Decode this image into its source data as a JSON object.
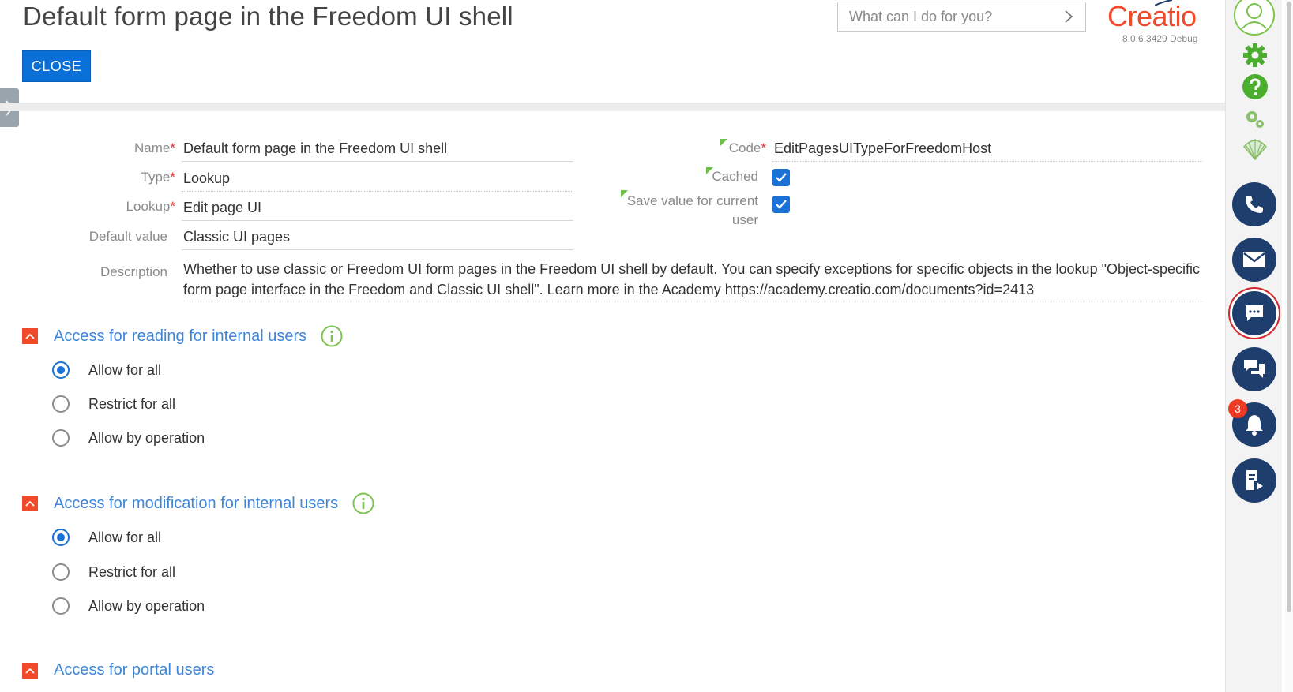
{
  "header": {
    "title": "Default form page in the Freedom UI shell",
    "close_label": "CLOSE",
    "search_placeholder": "What can I do for you?",
    "logo_text": "Creatio",
    "version": "8.0.6.3429 Debug"
  },
  "form": {
    "name_label": "Name",
    "name_value": "Default form page in the Freedom UI shell",
    "type_label": "Type",
    "type_value": "Lookup",
    "lookup_label": "Lookup",
    "lookup_value": "Edit page UI",
    "default_value_label": "Default value",
    "default_value_value": "Classic UI pages",
    "description_label": "Description",
    "description_value": "Whether to use classic or Freedom UI form pages in the Freedom UI shell by default. You can specify exceptions for specific objects in the lookup \"Object-specific form page interface in the Freedom and Classic UI shell\". Learn more in the Academy https://academy.creatio.com/documents?id=2413",
    "code_label": "Code",
    "code_value": "EditPagesUITypeForFreedomHost",
    "cached_label": "Cached",
    "cached_checked": true,
    "save_value_label_line1": "Save value for current",
    "save_value_label_line2": "user",
    "save_value_checked": true,
    "required_mark": "*"
  },
  "sections": [
    {
      "title": "Access for reading for internal users",
      "options": [
        "Allow for all",
        "Restrict for all",
        "Allow by operation"
      ],
      "selected": 0
    },
    {
      "title": "Access for modification for internal users",
      "options": [
        "Allow for all",
        "Restrict for all",
        "Allow by operation"
      ],
      "selected": 0
    },
    {
      "title": "Access for portal users"
    }
  ],
  "rail": {
    "notification_count": "3",
    "icons": [
      "profile-icon",
      "gear-icon",
      "help-icon",
      "system-settings-icon",
      "shell-icon",
      "phone-icon",
      "email-icon",
      "chat-icon",
      "feed-icon",
      "bell-icon",
      "process-icon"
    ]
  },
  "colors": {
    "accent": "#0a6fd6",
    "brand": "#ee4a2b",
    "rail_button": "#1e3e6e",
    "section_link": "#3f86d8",
    "required": "#e4312d",
    "green": "#4cae2e"
  }
}
